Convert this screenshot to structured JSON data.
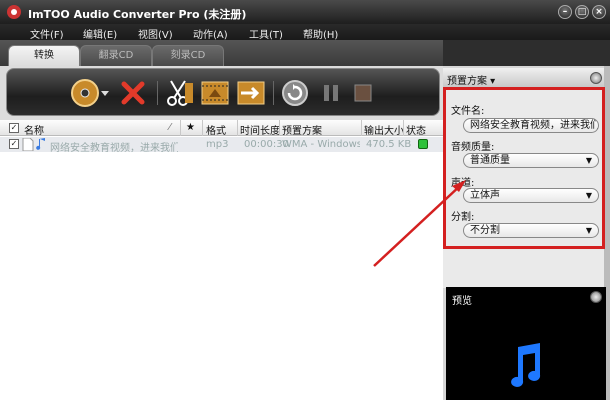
{
  "window": {
    "title": "ImTOO Audio Converter Pro (未注册)"
  },
  "menu": [
    "文件(F)",
    "编辑(E)",
    "视图(V)",
    "动作(A)",
    "工具(T)",
    "帮助(H)"
  ],
  "tabs": [
    {
      "label": "转换",
      "active": true
    },
    {
      "label": "翻录CD",
      "active": false
    },
    {
      "label": "刻录CD",
      "active": false
    }
  ],
  "toolbar": {
    "icons": [
      "add-cd-icon",
      "dropdown-arrow-icon",
      "delete-icon",
      "cut-icon",
      "add-segment-icon",
      "export-icon",
      "refresh-icon",
      "pause-icon",
      "stop-icon"
    ]
  },
  "grid": {
    "columns": [
      "名称",
      "★",
      "格式",
      "时间长度",
      "预置方案",
      "输出大小",
      "状态"
    ],
    "rows": [
      {
        "name": "网络安全教育视频，进来我们一...",
        "format": "mp3",
        "duration": "00:00:30",
        "preset": "WMA - Windows...",
        "size": "470.5 KB"
      }
    ]
  },
  "panel": {
    "preset_label": "预置方案",
    "filename_label": "文件名:",
    "filename_value": "网络安全教育视频，进来我们一起",
    "quality_label": "音频质量:",
    "quality_value": "普通质量",
    "channel_label": "声道:",
    "channel_value": "立体声",
    "split_label": "分割:",
    "split_value": "不分割",
    "preview_label": "预览"
  },
  "colors": {
    "highlight": "#d42020",
    "accent_blue": "#1e78ff"
  }
}
